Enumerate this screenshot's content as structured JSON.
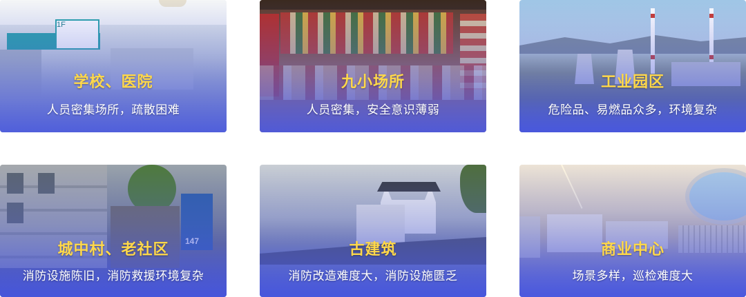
{
  "cards": [
    {
      "title": "学校、医院",
      "subtitle": "人员密集场所，疏散困难"
    },
    {
      "title": "九小场所",
      "subtitle": "人员密集，安全意识薄弱"
    },
    {
      "title": "工业园区",
      "subtitle": "危险品、易燃品众多，环境复杂"
    },
    {
      "title": "城中村、老社区",
      "subtitle": "消防设施陈旧，消防救援环境复杂"
    },
    {
      "title": "古建筑",
      "subtitle": "消防改造难度大，消防设施匮乏"
    },
    {
      "title": "商业中心",
      "subtitle": "场景多样，巡检难度大"
    }
  ],
  "colors": {
    "title": "#ffd84a",
    "subtitle": "#ffffff",
    "overlay_blue": "#4655e1"
  },
  "scene_labels": {
    "hospital_sign": "1F",
    "street_number": "147"
  }
}
